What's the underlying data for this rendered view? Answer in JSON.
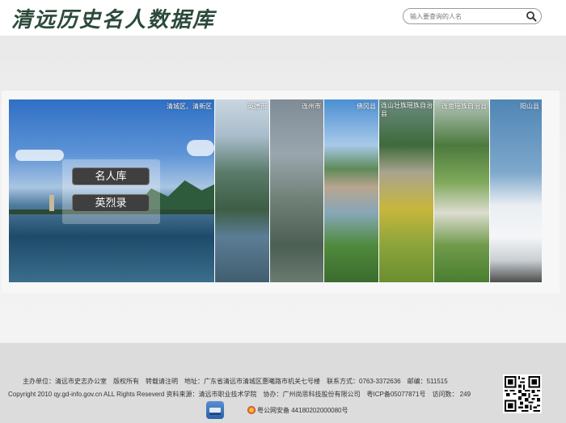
{
  "header": {
    "title": "清远历史名人数据库",
    "search_placeholder": "输入要查询的人名"
  },
  "gallery": {
    "panels": [
      {
        "label": "清城区、清新区"
      },
      {
        "label": "英德市"
      },
      {
        "label": "连州市"
      },
      {
        "label": "佛冈县"
      },
      {
        "label": "连山壮族瑶族自治县"
      },
      {
        "label": "连南瑶族自治县"
      },
      {
        "label": "阳山县"
      }
    ],
    "buttons": {
      "celebrities": "名人库",
      "martyrs": "英烈录"
    }
  },
  "footer": {
    "line1": "主办单位：清远市史志办公室　版权所有　转载请注明　地址：广东省清远市清城区惠曦路市机关七号楼　联系方式：0763-3372636　邮编：511515",
    "line2": "Copyright 2010 qy.gd-info.gov.cn ALL Rights Reseverd 资料来源：清远市职业技术学院　协办：广州尚思科技股份有限公司　粤ICP备05077871号　访问数：  249",
    "police_record": "粤公网安备 44180202000080号"
  }
}
